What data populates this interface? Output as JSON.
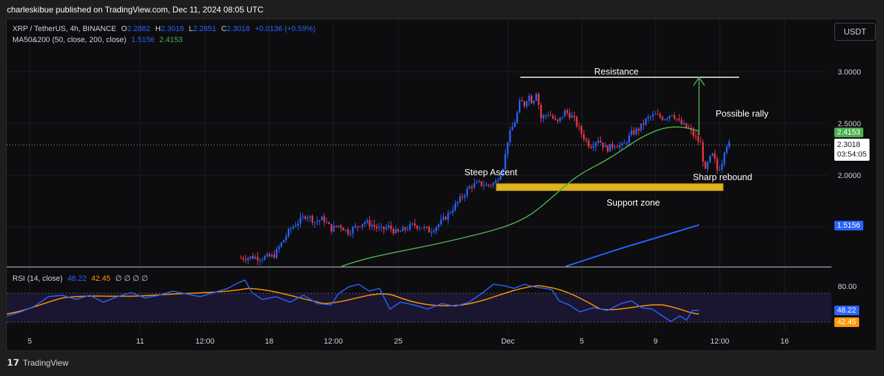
{
  "publisher_line": "charleskibue published on TradingView.com, Dec 11, 2024 08:05 UTC",
  "currency_button": "USDT",
  "legend": {
    "symbol": "XRP / TetherUS, 4h, BINANCE",
    "o_label": "O",
    "o_value": "2.2882",
    "h_label": "H",
    "h_value": "2.3018",
    "l_label": "L",
    "l_value": "2.2851",
    "c_label": "C",
    "c_value": "2.3018",
    "change": "+0.0136 (+0.59%)",
    "ma_label": "MA50&200 (50, close, 200, close)",
    "ma50_value": "1.5156",
    "ma200_value": "2.4153"
  },
  "rsi_legend": {
    "label": "RSI (14, close)",
    "rsi_value": "48.22",
    "ma_value": "42.45",
    "extras": "∅ ∅ ∅ ∅"
  },
  "price_axis": {
    "ticks": [
      "3.0000",
      "2.5000",
      "2.0000"
    ],
    "tag_ma_green": "2.4153",
    "tag_last_price": "2.3018",
    "tag_countdown": "03:54:05",
    "tag_ma_blue": "1.5156"
  },
  "rsi_axis": {
    "tick": "80.00",
    "tag_rsi": "48.22",
    "tag_ma": "42.45"
  },
  "time_axis": [
    "5",
    "11",
    "12:00",
    "18",
    "12:00",
    "25",
    "Dec",
    "5",
    "9",
    "12:00",
    "16"
  ],
  "annotations": {
    "resistance": "Resistance",
    "possible_rally": "Possible rally",
    "steep_ascent": "Steep Ascent",
    "sharp_rebound": "Sharp rebound",
    "support_zone": "Support zone"
  },
  "colors": {
    "up": "#2962ff",
    "down": "#f23645",
    "ma_green": "#4caf50",
    "ma_blue": "#2962ff",
    "rsi": "#2962ff",
    "rsi_ma": "#ff9800",
    "support": "#e0b21e",
    "arrow": "#4caf50"
  },
  "footer_brand": "TradingView",
  "chart_data": {
    "type": "candlestick",
    "title": "XRP / TetherUS, 4h, BINANCE",
    "ylim": [
      1.15,
      3.15
    ],
    "resistance_level": 2.94,
    "support_zone": [
      1.85,
      1.92
    ],
    "close_path": [
      [
        0.0,
        1.1
      ],
      [
        0.03,
        1.11
      ],
      [
        0.06,
        1.12
      ],
      [
        0.09,
        1.1
      ],
      [
        0.12,
        1.11
      ],
      [
        0.15,
        1.1
      ],
      [
        0.18,
        1.13
      ],
      [
        0.21,
        1.12
      ],
      [
        0.22,
        1.3
      ],
      [
        0.225,
        1.25
      ],
      [
        0.24,
        1.22
      ],
      [
        0.255,
        1.2
      ],
      [
        0.27,
        1.22
      ],
      [
        0.285,
        1.2
      ],
      [
        0.3,
        1.21
      ],
      [
        0.31,
        1.2
      ],
      [
        0.325,
        1.22
      ],
      [
        0.335,
        1.35
      ],
      [
        0.345,
        1.48
      ],
      [
        0.355,
        1.55
      ],
      [
        0.365,
        1.62
      ],
      [
        0.375,
        1.55
      ],
      [
        0.385,
        1.58
      ],
      [
        0.395,
        1.48
      ],
      [
        0.405,
        1.52
      ],
      [
        0.415,
        1.45
      ],
      [
        0.425,
        1.5
      ],
      [
        0.435,
        1.55
      ],
      [
        0.445,
        1.52
      ],
      [
        0.455,
        1.47
      ],
      [
        0.465,
        1.5
      ],
      [
        0.475,
        1.44
      ],
      [
        0.485,
        1.48
      ],
      [
        0.495,
        1.52
      ],
      [
        0.505,
        1.5
      ],
      [
        0.515,
        1.46
      ],
      [
        0.525,
        1.52
      ],
      [
        0.535,
        1.6
      ],
      [
        0.545,
        1.7
      ],
      [
        0.555,
        1.8
      ],
      [
        0.565,
        1.9
      ],
      [
        0.575,
        1.92
      ],
      [
        0.585,
        1.9
      ],
      [
        0.595,
        1.93
      ],
      [
        0.605,
        2.1
      ],
      [
        0.61,
        2.35
      ],
      [
        0.62,
        2.55
      ],
      [
        0.625,
        2.72
      ],
      [
        0.63,
        2.68
      ],
      [
        0.635,
        2.78
      ],
      [
        0.64,
        2.7
      ],
      [
        0.645,
        2.82
      ],
      [
        0.65,
        2.55
      ],
      [
        0.66,
        2.6
      ],
      [
        0.67,
        2.5
      ],
      [
        0.68,
        2.62
      ],
      [
        0.69,
        2.55
      ],
      [
        0.7,
        2.4
      ],
      [
        0.71,
        2.28
      ],
      [
        0.72,
        2.35
      ],
      [
        0.73,
        2.25
      ],
      [
        0.74,
        2.3
      ],
      [
        0.75,
        2.28
      ],
      [
        0.76,
        2.4
      ],
      [
        0.77,
        2.45
      ],
      [
        0.78,
        2.55
      ],
      [
        0.79,
        2.58
      ],
      [
        0.8,
        2.55
      ],
      [
        0.81,
        2.6
      ],
      [
        0.82,
        2.5
      ],
      [
        0.83,
        2.45
      ],
      [
        0.84,
        2.35
      ],
      [
        0.845,
        2.3
      ],
      [
        0.85,
        2.02
      ],
      [
        0.855,
        2.15
      ],
      [
        0.86,
        2.2
      ],
      [
        0.865,
        2.05
      ],
      [
        0.87,
        2.1
      ],
      [
        0.875,
        2.3
      ],
      [
        0.88,
        2.3
      ]
    ],
    "series": [
      {
        "name": "MA50",
        "value_last": 2.4153
      },
      {
        "name": "MA200",
        "value_last": 1.5156
      },
      {
        "name": "RSI (14, close)",
        "value_last": 48.22
      },
      {
        "name": "RSI MA",
        "value_last": 42.45
      }
    ]
  }
}
